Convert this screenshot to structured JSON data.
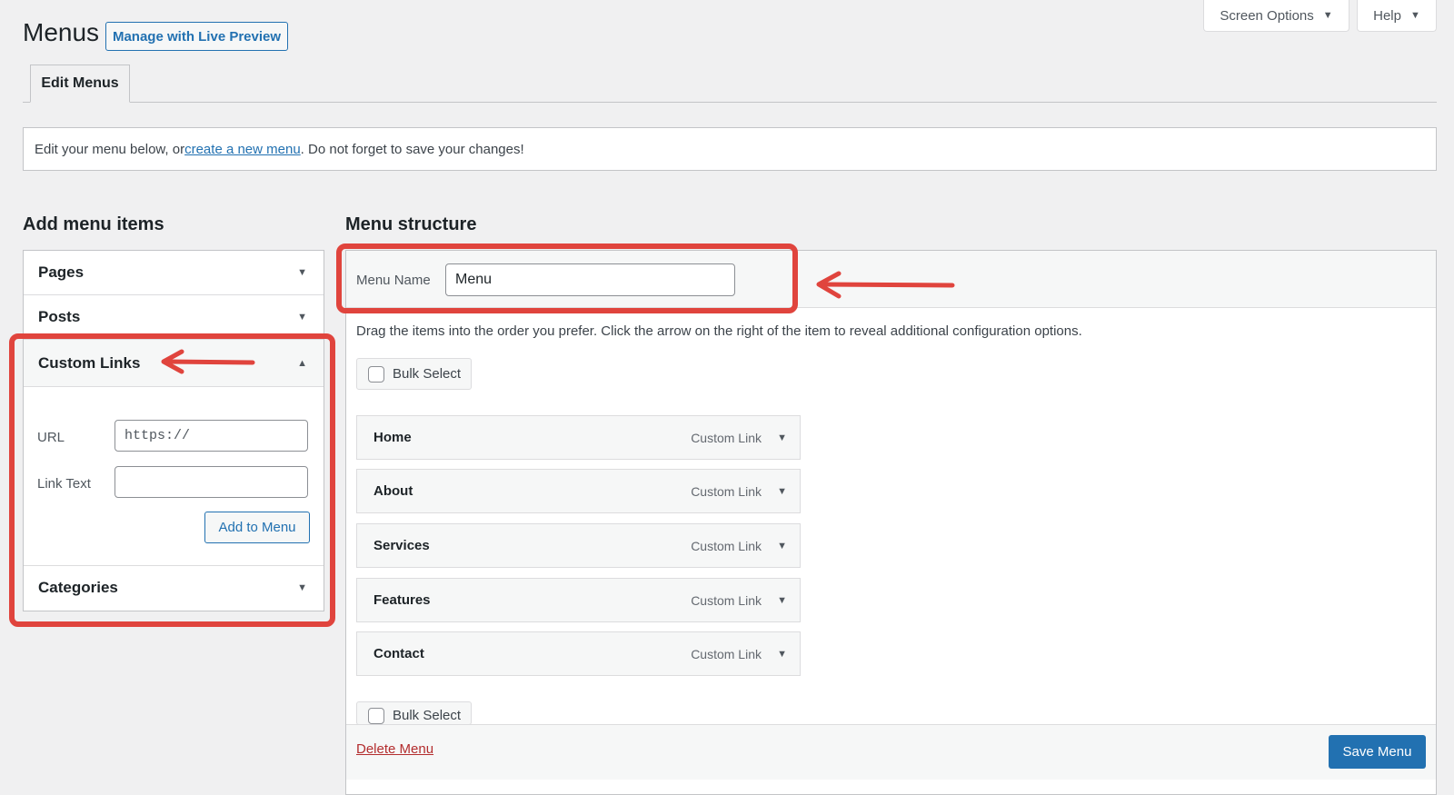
{
  "header": {
    "title": "Menus",
    "live_preview_button": "Manage with Live Preview",
    "screen_options": "Screen Options",
    "help": "Help"
  },
  "tabs": [
    {
      "label": "Edit Menus",
      "active": true
    }
  ],
  "notice": {
    "prefix": "Edit your menu below, or ",
    "link": "create a new menu",
    "suffix": ". Do not forget to save your changes!"
  },
  "left": {
    "heading": "Add menu items",
    "sections": [
      {
        "label": "Pages",
        "expanded": false
      },
      {
        "label": "Posts",
        "expanded": false
      },
      {
        "label": "Custom Links",
        "expanded": true
      },
      {
        "label": "Categories",
        "expanded": false
      }
    ],
    "custom_links": {
      "url_label": "URL",
      "url_value": "https://",
      "link_text_label": "Link Text",
      "link_text_value": "",
      "add_button": "Add to Menu"
    }
  },
  "right": {
    "heading": "Menu structure",
    "menu_name_label": "Menu Name",
    "menu_name_value": "Menu",
    "instructions": "Drag the items into the order you prefer. Click the arrow on the right of the item to reveal additional configuration options.",
    "bulk_select": "Bulk Select",
    "items": [
      {
        "name": "Home",
        "type": "Custom Link"
      },
      {
        "name": "About",
        "type": "Custom Link"
      },
      {
        "name": "Services",
        "type": "Custom Link"
      },
      {
        "name": "Features",
        "type": "Custom Link"
      },
      {
        "name": "Contact",
        "type": "Custom Link"
      }
    ],
    "delete_menu": "Delete Menu",
    "save_menu": "Save Menu"
  },
  "colors": {
    "accent": "#2271b1",
    "highlight": "#e0443d",
    "delete": "#b32d2e"
  },
  "icons": [
    "triangle-down-icon",
    "triangle-up-icon",
    "arrow-annotation-icon"
  ]
}
